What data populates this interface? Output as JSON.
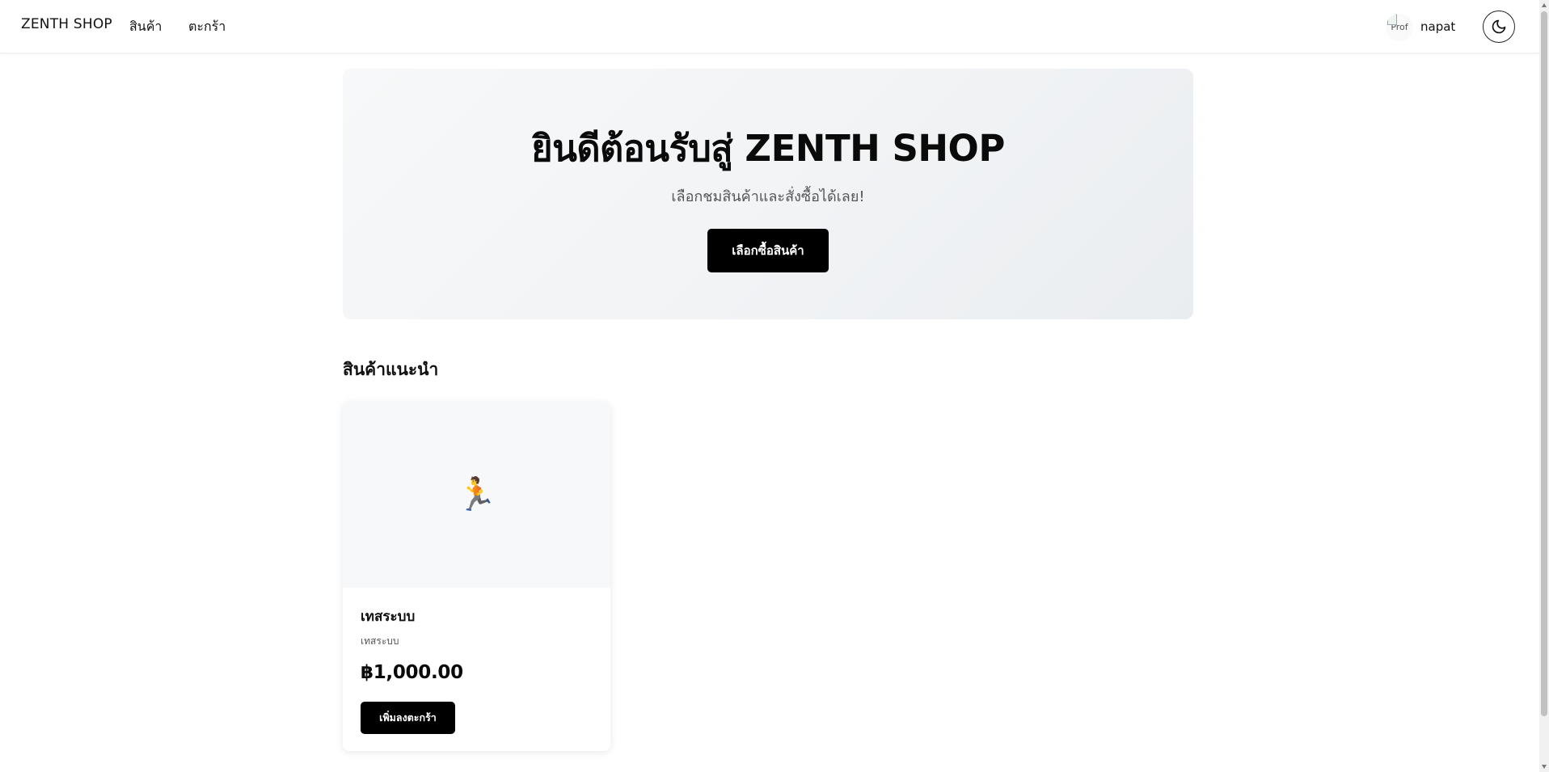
{
  "navbar": {
    "brand": "ZENTH SHOP",
    "links": [
      {
        "label": "สินค้า"
      },
      {
        "label": "ตะกร้า"
      }
    ],
    "profile_alt": "Prof",
    "username": "napat",
    "theme_toggle_icon": "moon-icon"
  },
  "hero": {
    "title": "ยินดีต้อนรับสู่ ZENTH SHOP",
    "subtitle": "เลือกชมสินค้าและสั่งซื้อได้เลย!",
    "cta_label": "เลือกซื้อสินค้า"
  },
  "featured": {
    "title": "สินค้าแนะนำ",
    "products": [
      {
        "image_icon": "running-person-emoji",
        "image_glyph": "🏃",
        "name": "เทสระบบ",
        "description": "เทสระบบ",
        "price": "฿1,000.00",
        "button_label": "เพิ่มลงตะกร้า"
      }
    ]
  },
  "colors": {
    "primary_button": "#000000",
    "hero_background": "#f1f3f5",
    "card_image_background": "#f7f8f9"
  }
}
